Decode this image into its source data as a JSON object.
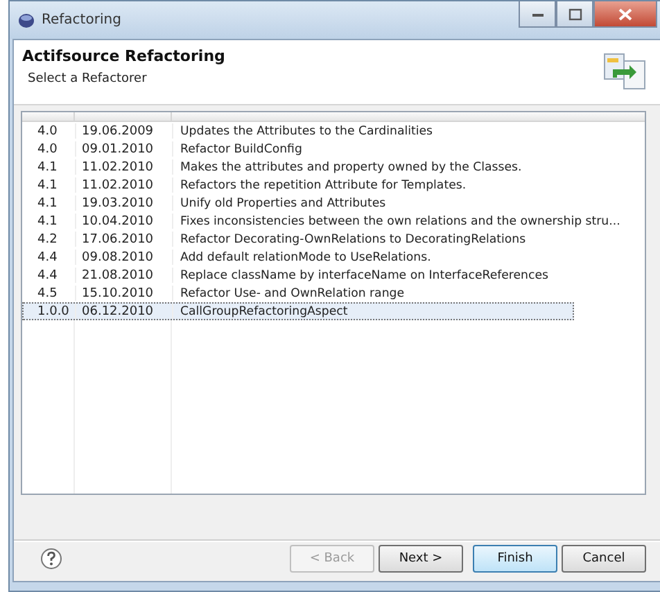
{
  "window": {
    "title": "Refactoring"
  },
  "header": {
    "title": "Actifsource Refactoring",
    "subtitle": "Select a Refactorer"
  },
  "table": {
    "rows": [
      {
        "cells": [
          "4.0",
          "19.06.2009",
          "Updates the Attributes to the Cardinalities"
        ],
        "selected": false
      },
      {
        "cells": [
          "4.0",
          "09.01.2010",
          "Refactor BuildConfig"
        ],
        "selected": false
      },
      {
        "cells": [
          "4.1",
          "11.02.2010",
          "Makes the attributes and property owned by the Classes."
        ],
        "selected": false
      },
      {
        "cells": [
          "4.1",
          "11.02.2010",
          "Refactors the repetition Attribute for Templates."
        ],
        "selected": false
      },
      {
        "cells": [
          "4.1",
          "19.03.2010",
          "Unify old Properties and Attributes"
        ],
        "selected": false
      },
      {
        "cells": [
          "4.1",
          "10.04.2010",
          "Fixes inconsistencies between the own relations and the ownership stru..."
        ],
        "selected": false
      },
      {
        "cells": [
          "4.2",
          "17.06.2010",
          "Refactor Decorating-OwnRelations to DecoratingRelations"
        ],
        "selected": false
      },
      {
        "cells": [
          "4.4",
          "09.08.2010",
          "Add default relationMode to UseRelations."
        ],
        "selected": false
      },
      {
        "cells": [
          "4.4",
          "21.08.2010",
          "Replace className by interfaceName on InterfaceReferences"
        ],
        "selected": false
      },
      {
        "cells": [
          "4.5",
          "15.10.2010",
          "Refactor Use- and OwnRelation range"
        ],
        "selected": false
      },
      {
        "cells": [
          "1.0.0",
          "06.12.2010",
          "CallGroupRefactoringAspect"
        ],
        "selected": true
      }
    ]
  },
  "buttons": [
    {
      "label": "< Back",
      "disabled": true,
      "default": false
    },
    {
      "label": "Next >",
      "disabled": false,
      "default": false
    },
    {
      "label": "Finish",
      "disabled": false,
      "default": true
    },
    {
      "label": "Cancel",
      "disabled": false,
      "default": false
    }
  ]
}
